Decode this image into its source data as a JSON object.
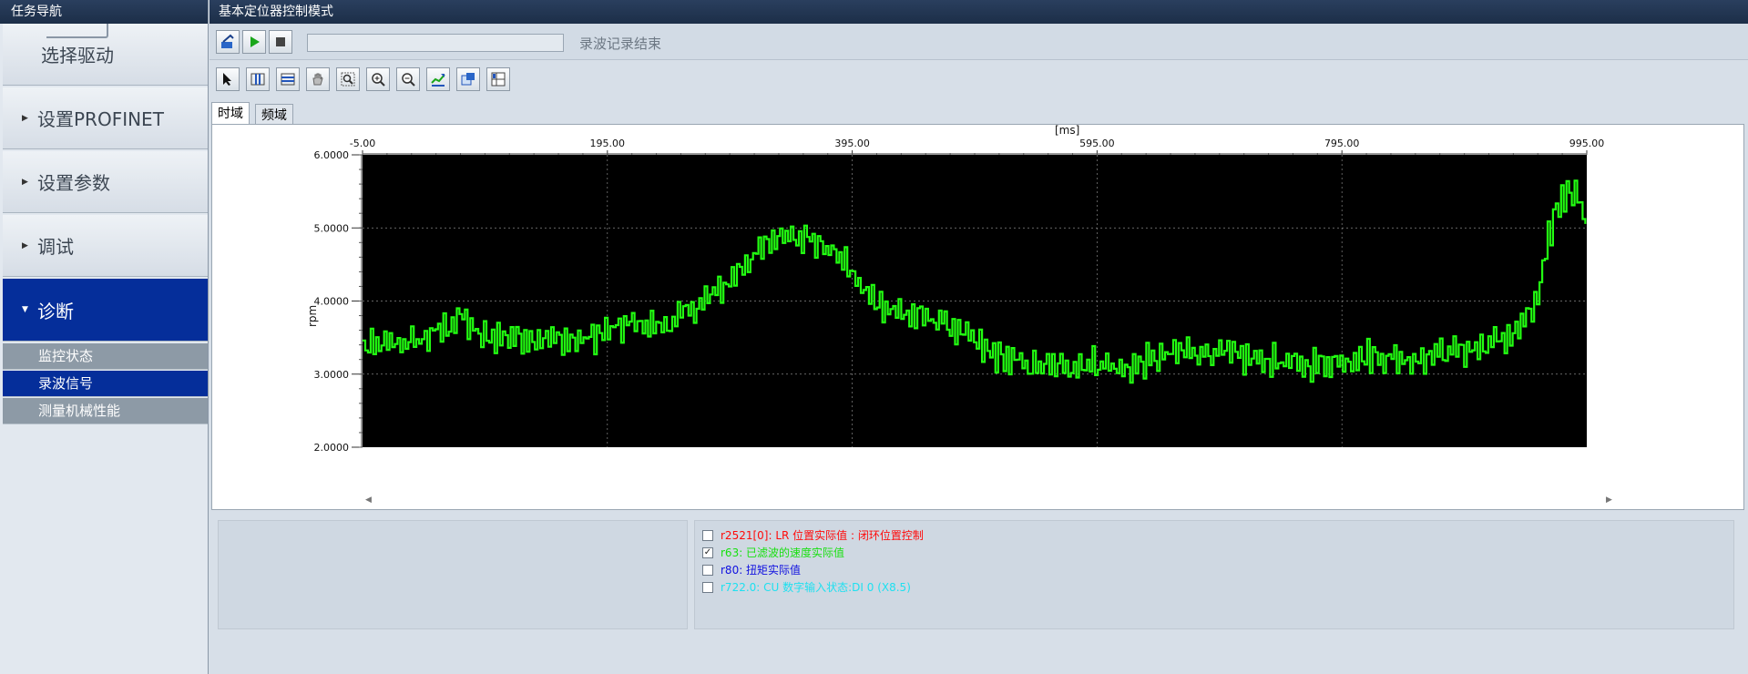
{
  "nav": {
    "title": "任务导航",
    "steps": [
      {
        "label": "选择驱动",
        "active": false
      },
      {
        "label": "设置PROFINET",
        "active": false
      },
      {
        "label": "设置参数",
        "active": false
      },
      {
        "label": "调试",
        "active": false
      },
      {
        "label": "诊断",
        "active": true
      }
    ],
    "sub_items": [
      {
        "label": "监控状态",
        "active": false
      },
      {
        "label": "录波信号",
        "active": true
      },
      {
        "label": "测量机械性能",
        "active": false
      }
    ]
  },
  "main": {
    "title": "基本定位器控制模式",
    "status": "录波记录结束",
    "tabs": [
      {
        "label": "时域",
        "active": true
      },
      {
        "label": "频域",
        "active": false
      }
    ]
  },
  "chart_data": {
    "type": "line",
    "x_unit_label": "[ms]",
    "ylabel": "rpm",
    "xlim": [
      -5,
      995
    ],
    "ylim": [
      2,
      6
    ],
    "x_ticks": [
      -5,
      195,
      395,
      595,
      795,
      995
    ],
    "x_tick_labels": [
      "-5.00",
      "195.00",
      "395.00",
      "595.00",
      "795.00",
      "995.00"
    ],
    "y_ticks": [
      2,
      3,
      4,
      5,
      6
    ],
    "y_tick_labels": [
      "2.0000",
      "3.0000",
      "4.0000",
      "5.0000",
      "6.0000"
    ],
    "grid": true,
    "background": "#000000",
    "series": [
      {
        "name": "r63: 已滤波的速度实际值",
        "color": "#22ff11",
        "envelope_x": [
          -5,
          20,
          40,
          60,
          75,
          90,
          110,
          140,
          170,
          195,
          215,
          240,
          265,
          290,
          305,
          320,
          335,
          345,
          365,
          385,
          405,
          425,
          445,
          465,
          485,
          505,
          525,
          545,
          565,
          585,
          600,
          615,
          640,
          665,
          690,
          715,
          740,
          760,
          780,
          800,
          820,
          850,
          880,
          905,
          920,
          935,
          945,
          955,
          960,
          967,
          975,
          985,
          995
        ],
        "envelope_y": [
          3.35,
          3.42,
          3.45,
          3.62,
          3.8,
          3.5,
          3.52,
          3.5,
          3.45,
          3.58,
          3.7,
          3.65,
          3.9,
          4.2,
          4.5,
          4.7,
          4.9,
          4.95,
          4.8,
          4.6,
          4.1,
          3.9,
          3.78,
          3.75,
          3.55,
          3.3,
          3.18,
          3.1,
          3.1,
          3.15,
          3.15,
          3.05,
          3.2,
          3.32,
          3.3,
          3.22,
          3.18,
          3.12,
          3.15,
          3.22,
          3.25,
          3.2,
          3.32,
          3.35,
          3.45,
          3.55,
          3.75,
          4.05,
          4.55,
          5.15,
          5.45,
          5.55,
          5.05
        ]
      }
    ]
  },
  "signals": [
    {
      "label": "r2521[0]: LR 位置实际值 : 闭环位置控制",
      "checked": false,
      "color": "#ff0a0a"
    },
    {
      "label": "r63: 已滤波的速度实际值",
      "checked": true,
      "color": "#18e010"
    },
    {
      "label": "r80: 扭矩实际值",
      "checked": false,
      "color": "#1010e0"
    },
    {
      "label": "r722.0: CU 数字输入状态:DI 0 (X8.5)",
      "checked": false,
      "color": "#1ee0f0"
    }
  ]
}
